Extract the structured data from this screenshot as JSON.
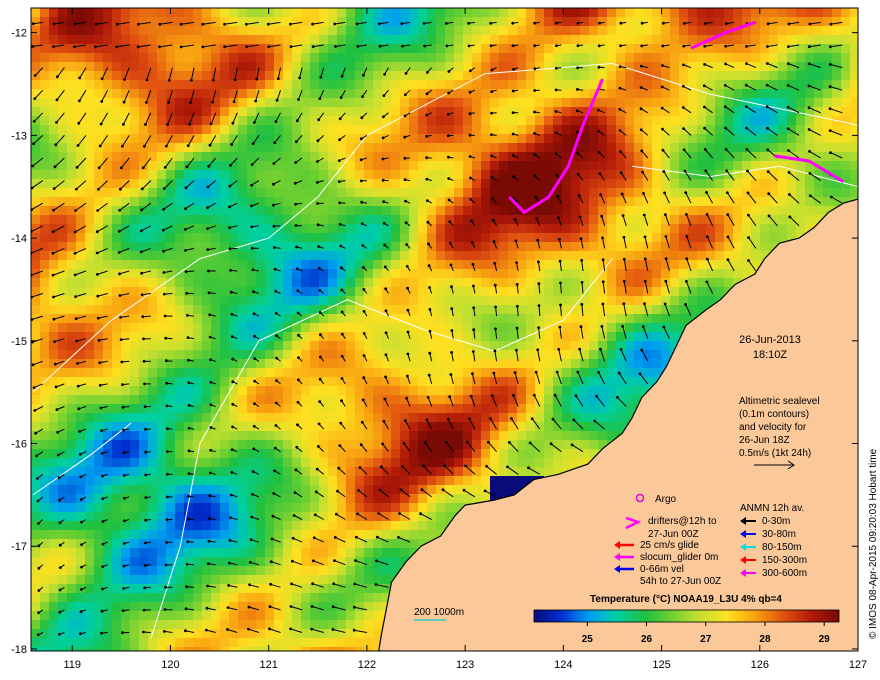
{
  "map": {
    "lon_ticks": [
      119,
      120,
      121,
      122,
      123,
      124,
      125,
      126,
      127
    ],
    "lat_ticks": [
      -12,
      -13,
      -14,
      -15,
      -16,
      -17,
      -18
    ],
    "lon_range": [
      118.58,
      127.0
    ],
    "lat_range": [
      -11.76,
      -18.02
    ],
    "land_color": "#fbc89a",
    "deep_color": "#14145a"
  },
  "date": {
    "day": "26-Jun-2013",
    "time": "18:10Z"
  },
  "sealevel_note": {
    "line1": "Altimetric sealevel",
    "line2": "(0.1m contours)",
    "line3": "and velocity for",
    "line4": "26-Jun 18Z",
    "line5": "0.5m/s (1kt 24h)"
  },
  "argo": {
    "label": "Argo",
    "color": "#e000e0"
  },
  "drifters": {
    "line1": "drifters@12h to",
    "line2": "27-Jun 00Z",
    "color": "#ff00ff"
  },
  "glider_legend": [
    {
      "label": "25 cm/s glide",
      "color": "#ff0000"
    },
    {
      "label": "slocum_glider 0m",
      "color": "#ff00ff"
    },
    {
      "label": "0-66m vel",
      "color": "#0000ff"
    },
    {
      "label": "54h to 27-Jun 00Z",
      "color": ""
    }
  ],
  "anmn": {
    "title": "ANMN 12h av.",
    "items": [
      {
        "label": "0-30m",
        "color": "#000000"
      },
      {
        "label": "30-80m",
        "color": "#0000ff"
      },
      {
        "label": "80-150m",
        "color": "#00e0e0"
      },
      {
        "label": "150-300m",
        "color": "#ff0000"
      },
      {
        "label": "300-600m",
        "color": "#ff00ff"
      }
    ]
  },
  "depth_contours": {
    "label": "200  1000m",
    "color": "#00cccc"
  },
  "colorbar": {
    "title": "Temperature (°C) NOAA19_L3U 4% qb=4",
    "ticks": [
      "25",
      "26",
      "27",
      "28",
      "29"
    ],
    "tick_values": [
      25,
      26,
      27,
      28,
      29
    ],
    "range": [
      24.1,
      29.25
    ],
    "stops": [
      "#0a0a7a",
      "#0030d0",
      "#00a0f0",
      "#00d0a0",
      "#20c040",
      "#70d030",
      "#c8e030",
      "#ffe020",
      "#f8a010",
      "#e05010",
      "#b01a08",
      "#7a0a04"
    ]
  },
  "credit": "© IMOS 08-Apr-2015 09:20:03 Hobart time"
}
